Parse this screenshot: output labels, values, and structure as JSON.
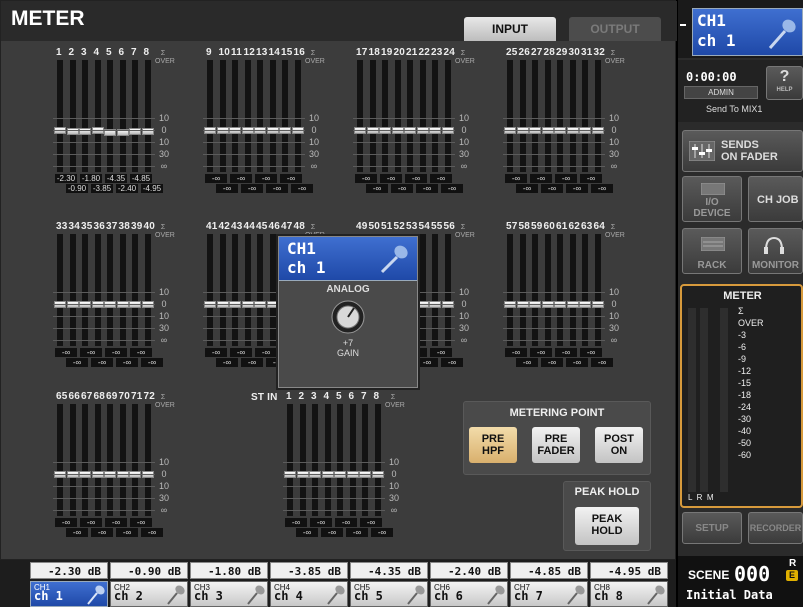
{
  "window": {
    "title": "METER"
  },
  "tabs": {
    "input": "INPUT",
    "output": "OUTPUT"
  },
  "meters": {
    "row1_channels": [
      "1",
      "2",
      "3",
      "4",
      "5",
      "6",
      "7",
      "8",
      "9",
      "10",
      "11",
      "12",
      "13",
      "14",
      "15",
      "16",
      "17",
      "18",
      "19",
      "20",
      "21",
      "22",
      "23",
      "24",
      "25",
      "26",
      "27",
      "28",
      "29",
      "30",
      "31",
      "32"
    ],
    "row2_channels": [
      "33",
      "34",
      "35",
      "36",
      "37",
      "38",
      "39",
      "40",
      "41",
      "42",
      "43",
      "44",
      "45",
      "46",
      "47",
      "48",
      "49",
      "50",
      "51",
      "52",
      "53",
      "54",
      "55",
      "56",
      "57",
      "58",
      "59",
      "60",
      "61",
      "62",
      "63",
      "64"
    ],
    "row3_channels": [
      "65",
      "66",
      "67",
      "68",
      "69",
      "70",
      "71",
      "72"
    ],
    "stin_label": "ST IN",
    "stin_channels": [
      "1",
      "2",
      "3",
      "4",
      "5",
      "6",
      "7",
      "8"
    ],
    "over_label": "OVER",
    "sigma": "Σ",
    "scale_labels": [
      "10",
      "0",
      "10",
      "30",
      "∞"
    ],
    "row1_values_group1": [
      "-2.30",
      "-0.90",
      "-1.80",
      "-3.85",
      "-4.35",
      "-2.40",
      "-4.85",
      "-4.95"
    ],
    "inf_value": "-∞"
  },
  "popup": {
    "ch_id": "CH1",
    "ch_name": "ch 1",
    "source": "ANALOG",
    "gain_value": "+7",
    "gain_label": "GAIN"
  },
  "metering_point": {
    "title": "METERING POINT",
    "buttons": [
      {
        "line1": "PRE",
        "line2": "HPF",
        "active": true
      },
      {
        "line1": "PRE",
        "line2": "FADER",
        "active": false
      },
      {
        "line1": "POST",
        "line2": "ON",
        "active": false
      }
    ]
  },
  "peak_hold": {
    "title": "PEAK HOLD",
    "line1": "PEAK",
    "line2": "HOLD"
  },
  "bottom": {
    "db_values": [
      "-2.30 dB",
      "-0.90 dB",
      "-1.80 dB",
      "-3.85 dB",
      "-4.35 dB",
      "-2.40 dB",
      "-4.85 dB",
      "-4.95 dB"
    ],
    "channels": [
      {
        "id": "CH1",
        "name": "ch 1",
        "selected": true
      },
      {
        "id": "CH2",
        "name": "ch 2",
        "selected": false
      },
      {
        "id": "CH3",
        "name": "ch 3",
        "selected": false
      },
      {
        "id": "CH4",
        "name": "ch 4",
        "selected": false
      },
      {
        "id": "CH5",
        "name": "ch 5",
        "selected": false
      },
      {
        "id": "CH6",
        "name": "ch 6",
        "selected": false
      },
      {
        "id": "CH7",
        "name": "ch 7",
        "selected": false
      },
      {
        "id": "CH8",
        "name": "ch 8",
        "selected": false
      }
    ]
  },
  "right_panel": {
    "ch_id": "CH1",
    "ch_name": "ch 1",
    "time": "0:00:00",
    "user": "ADMIN",
    "help_label": "HELP",
    "send_to": "Send To MIX1",
    "sends_on_fader_1": "SENDS",
    "sends_on_fader_2": "ON FADER",
    "io_device_1": "I/O",
    "io_device_2": "DEVICE",
    "ch_job": "CH JOB",
    "rack": "RACK",
    "monitor": "MONITOR",
    "meter_title": "METER",
    "meter_scale": [
      "Σ",
      "OVER",
      "-3",
      "-6",
      "-9",
      "-12",
      "-15",
      "-18",
      "-24",
      "-30",
      "-40",
      "-50",
      "-60"
    ],
    "meter_lr": "L  R  M",
    "setup": "SETUP",
    "recorder": "RECORDER",
    "scene_label": "SCENE",
    "scene_number": "000",
    "scene_r": "R",
    "scene_e": "E",
    "scene_name": "Initial Data"
  },
  "colors": {
    "accent_blue": "#2a58c0",
    "active_button": "#e8c98a"
  }
}
